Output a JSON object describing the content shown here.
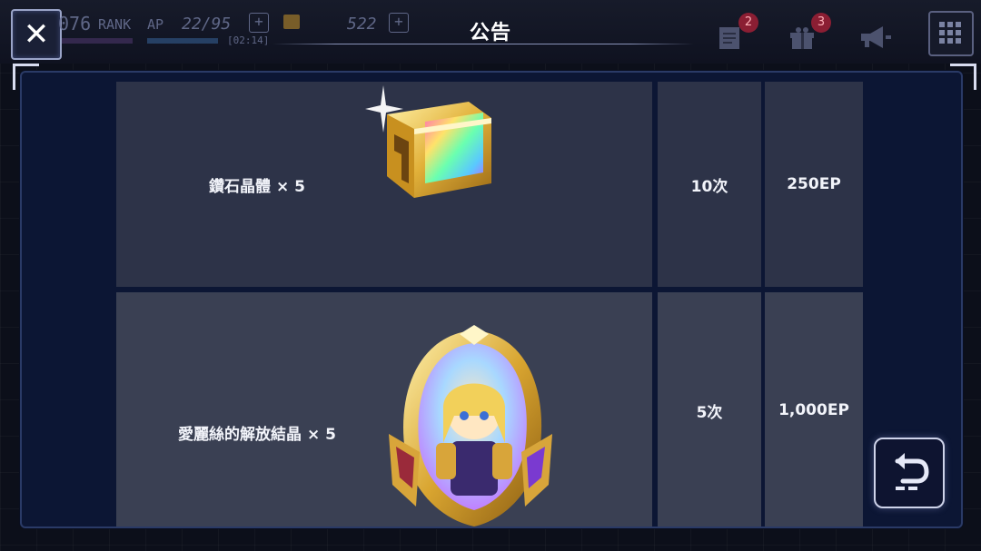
{
  "topbar": {
    "rank_number": "076",
    "rank_label": "RANK",
    "ap_label": "AP",
    "ap_value": "22/95",
    "ap_timer": "[02:14]",
    "gems_value": "522",
    "plus_symbol": "+",
    "title": "公告",
    "badges": {
      "notices": "2",
      "gifts": "3"
    }
  },
  "close_symbol": "✕",
  "rows": [
    {
      "item": "鑽石晶體 × 5",
      "times": "10次",
      "cost": "250EP",
      "icon": "diamond-crystal-box-icon"
    },
    {
      "item": "愛麗絲的解放結晶 × 5",
      "times": "5次",
      "cost": "1,000EP",
      "icon": "alice-release-crystal-icon"
    }
  ],
  "icons": {
    "close": "close-icon",
    "notices": "document-icon",
    "gifts": "gift-icon",
    "announcement": "megaphone-icon",
    "menu": "grid-menu-icon",
    "back": "back-return-icon"
  },
  "colors": {
    "panel_bg": "#0c1634",
    "row1_bg": "#2d3348",
    "row2_bg": "#3a4053",
    "text": "#f2f4fa",
    "badge": "#8b1e33"
  }
}
